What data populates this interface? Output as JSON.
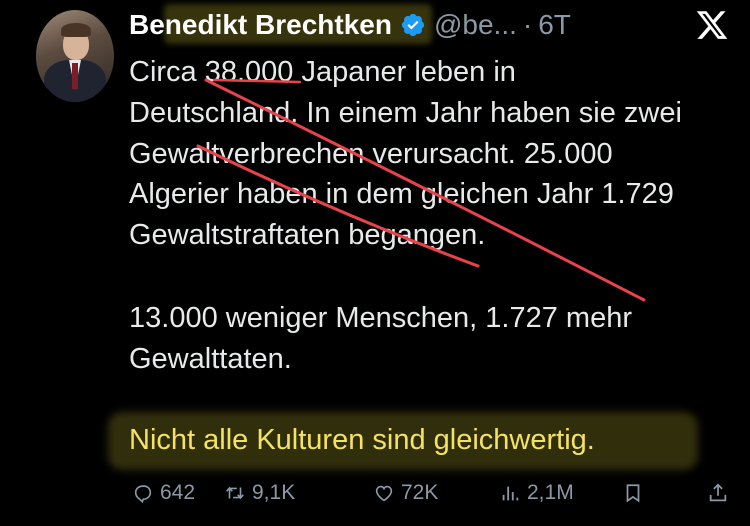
{
  "author": {
    "name": "Benedikt Brechtken",
    "handle": "@be...",
    "separator": "·",
    "time": "6T"
  },
  "tweet": {
    "paragraph1_lines": [
      "Circa 38.000 Japaner leben in",
      "Deutschland. In einem Jahr haben sie zwei",
      "Gewaltverbrechen verursacht. 25.000",
      "Algerier haben in dem gleichen Jahr 1.729",
      "Gewaltstraftaten begangen."
    ],
    "paragraph2_lines": [
      "13.000 weniger Menschen, 1.727 mehr",
      "Gewalttaten."
    ],
    "paragraph3": "Nicht alle Kulturen sind gleichwertig."
  },
  "actions": {
    "replies": "642",
    "retweets": "9,1K",
    "likes": "72K",
    "views": "2,1M"
  },
  "colors": {
    "background": "#000000",
    "text": "#e7e9ea",
    "muted": "#8b98a5",
    "verified": "#1d9bf0",
    "highlight": "#f4e264",
    "strike": "#e8424a"
  },
  "icons": [
    "verified-badge-icon",
    "x-logo-icon",
    "reply-icon",
    "retweet-icon",
    "like-icon",
    "views-icon",
    "bookmark-icon",
    "share-icon"
  ]
}
